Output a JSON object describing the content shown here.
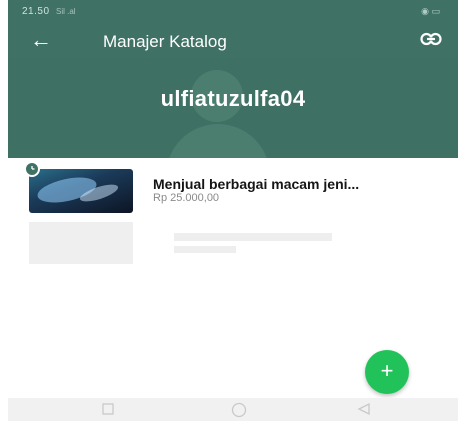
{
  "status_bar": {
    "time": "21.50",
    "signal_text": "Sil .al",
    "right_icons": "◉ ▭"
  },
  "app_bar": {
    "back_icon": "arrow-left-icon",
    "title": "Manajer Katalog",
    "link_icon": "link-icon"
  },
  "profile": {
    "name": "ulfiatuzulfa04"
  },
  "catalog": {
    "items": [
      {
        "title": "Menjual berbagai macam jeni...",
        "price": "Rp 25.000,00",
        "badge_icon": "clock-icon"
      }
    ]
  },
  "fab": {
    "label": "+",
    "icon": "add-icon"
  },
  "nav_bar": {
    "recent_icon": "square-icon",
    "home_icon": "circle-icon",
    "back_icon": "triangle-back-icon"
  },
  "colors": {
    "primary": "#3f7265",
    "fab": "#22c25a"
  }
}
